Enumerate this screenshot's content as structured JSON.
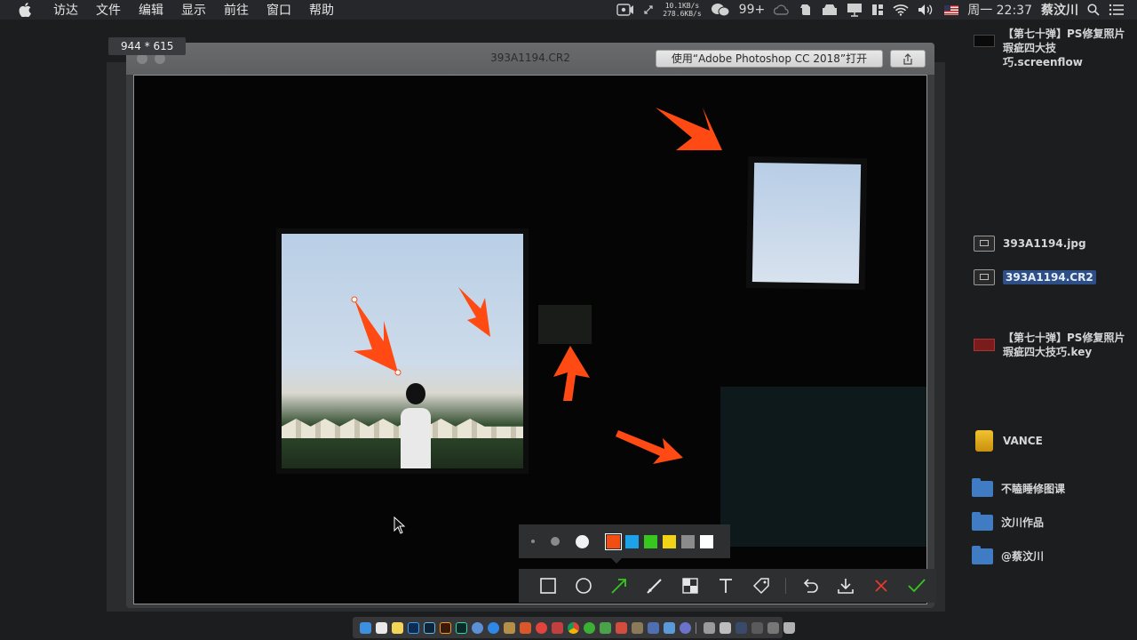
{
  "menubar": {
    "apple_icon": "apple-logo-icon",
    "items": [
      "访达",
      "文件",
      "编辑",
      "显示",
      "前往",
      "窗口",
      "帮助"
    ],
    "status": {
      "upload_speed": "10.1KB/s",
      "download_speed": "278.6KB/s",
      "wechat_badge": "99+",
      "clock": "周一 22:37",
      "user": "蔡汶川"
    }
  },
  "dimension_tag": "944 * 615",
  "preview_window": {
    "title": "393A1194.CR2",
    "open_with_label": "使用“Adobe Photoshop CC 2018”打开",
    "share_icon": "share-icon"
  },
  "annotation": {
    "pen_sizes": [
      "small",
      "medium",
      "large"
    ],
    "selected_size": "large",
    "colors": [
      "#f24d12",
      "#1ba2e8",
      "#37c71e",
      "#f0d317",
      "#8b8b8b",
      "#ffffff"
    ],
    "selected_color": "#f24d12",
    "tools": [
      "rectangle-tool",
      "ellipse-tool",
      "arrow-tool",
      "pen-tool",
      "mosaic-tool",
      "text-tool",
      "tag-tool",
      "undo-tool",
      "download-tool",
      "cancel-tool",
      "confirm-tool"
    ],
    "active_tool": "arrow-tool",
    "arrow_color": "#ff4a14"
  },
  "desktop": {
    "items": [
      {
        "label": "【第七十弹】PS修复照片瑕疵四大技巧.screenflow",
        "icon": "screenflow-file-icon"
      },
      {
        "label": "393A1194.jpg",
        "icon": "image-file-icon"
      },
      {
        "label": "393A1194.CR2",
        "icon": "image-file-icon",
        "selected": true
      },
      {
        "label": "【第七十弹】PS修复照片瑕疵四大技巧.key",
        "icon": "keynote-file-icon"
      },
      {
        "label": "VANCE",
        "icon": "drive-icon"
      },
      {
        "label": "不瞌睡修图课",
        "icon": "folder-icon"
      },
      {
        "label": "汶川作品",
        "icon": "folder-icon"
      },
      {
        "label": "@蔡汶川",
        "icon": "folder-icon"
      }
    ]
  },
  "colors": {
    "menubar_bg": "#26272a",
    "selection": "#2e4f86",
    "folder": "#3f7cc4"
  }
}
